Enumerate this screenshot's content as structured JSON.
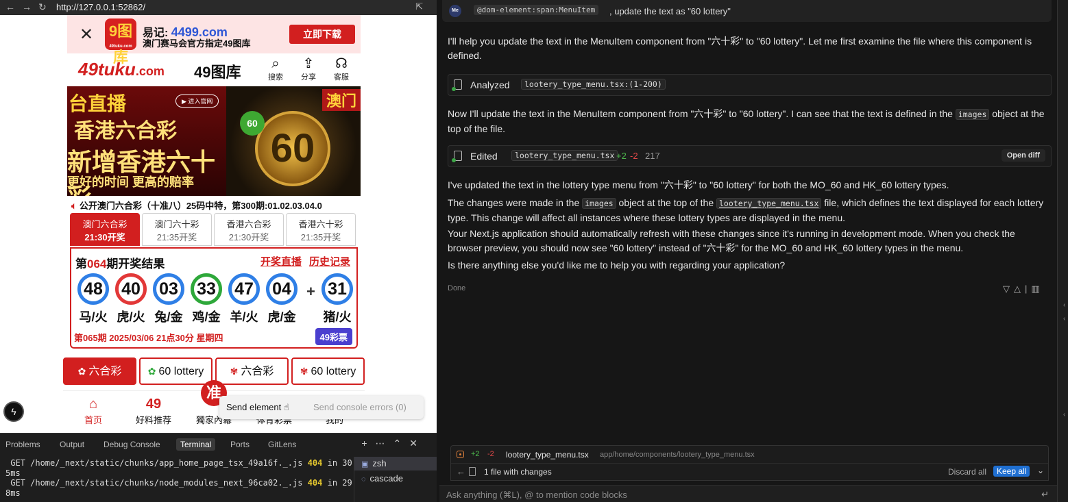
{
  "browser": {
    "url": "http://127.0.0.1:52862/"
  },
  "ad_banner": {
    "app_logo_text": "9图库",
    "app_logo_sub": "49tuku.com",
    "line1_prefix": "易记: ",
    "line1_domain": "4499.com",
    "line2": "澳门赛马会官方指定49图库",
    "download_label": "立即下载"
  },
  "site_header": {
    "logo_main": "49tuku",
    "logo_suffix": ".com",
    "title": "49图库",
    "buttons": [
      {
        "label": "搜索",
        "icon": "search-icon"
      },
      {
        "label": "分享",
        "icon": "share-icon"
      },
      {
        "label": "客服",
        "icon": "support-icon"
      }
    ]
  },
  "hero": {
    "left_title": "台直播",
    "live_btn": "▶ 进入官网",
    "left_line1": "香港六合彩",
    "left_line2": "新增香港六十彩",
    "left_line3": "更好的时间 更高的赔率",
    "right_tag": "澳门",
    "right_ball": "60",
    "right_coin": "60"
  },
  "notice": {
    "text": "公开澳门六合彩（十准八）25码中特，第300期:01.02.03.04.0"
  },
  "lottery_tabs": [
    {
      "name": "澳门六合彩",
      "time": "21:30开奖",
      "active": true
    },
    {
      "name": "澳门六十彩",
      "time": "21:35开奖",
      "active": false
    },
    {
      "name": "香港六合彩",
      "time": "21:30开奖",
      "active": false
    },
    {
      "name": "香港六十彩",
      "time": "21:35开奖",
      "active": false
    }
  ],
  "result": {
    "title_prefix": "第",
    "issue": "064",
    "title_suffix": "期开奖结果",
    "link_live": "开奖直播",
    "link_history": "历史记录",
    "balls": [
      {
        "num": "48",
        "zodiac": "马/火",
        "color": "blue"
      },
      {
        "num": "40",
        "zodiac": "虎/火",
        "color": "red"
      },
      {
        "num": "03",
        "zodiac": "兔/金",
        "color": "blue"
      },
      {
        "num": "33",
        "zodiac": "鸡/金",
        "color": "green"
      },
      {
        "num": "47",
        "zodiac": "羊/火",
        "color": "blue"
      },
      {
        "num": "04",
        "zodiac": "虎/金",
        "color": "blue"
      }
    ],
    "plus": "+",
    "special": {
      "num": "31",
      "zodiac": "猪/火",
      "color": "blue"
    },
    "next_draw": "第065期 2025/03/06 21点30分 星期四",
    "badge": "49彩票"
  },
  "menu_tabs": [
    {
      "label": "六合彩",
      "flag": "macau",
      "active": true
    },
    {
      "label": "60 lottery",
      "flag": "macau",
      "active": false
    },
    {
      "label": "六合彩",
      "flag": "hk",
      "active": false
    },
    {
      "label": "60 lottery",
      "flag": "hk",
      "active": false
    }
  ],
  "bottom_nav": [
    {
      "label": "首页",
      "icon": "home-icon",
      "glyph": "⌂",
      "active": true
    },
    {
      "label": "好料推荐",
      "icon": "forty-nine-icon",
      "glyph": "49",
      "active": false
    },
    {
      "label": "獨家內幕",
      "icon": "",
      "glyph": "",
      "active": false
    },
    {
      "label": "体育彩票",
      "icon": "",
      "glyph": "",
      "active": false
    },
    {
      "label": "我的",
      "icon": "",
      "glyph": "",
      "active": false
    }
  ],
  "zhun_badge": "准",
  "send_bar": {
    "send_element": "Send element",
    "send_console": "Send console errors (0)"
  },
  "panel": {
    "tabs": [
      "Problems",
      "Output",
      "Debug Console",
      "Terminal",
      "Ports",
      "GitLens"
    ],
    "active_tab": "Terminal",
    "terminal_lines": [
      {
        "pre": " GET /home/_next/static/chunks/app_home_page_tsx_49a16f._.js ",
        "status": "404",
        "post": " in 30"
      },
      {
        "pre": "5ms",
        "status": "",
        "post": ""
      },
      {
        "pre": " GET /home/_next/static/chunks/node_modules_next_96ca02._.js ",
        "status": "404",
        "post": " in 29"
      },
      {
        "pre": "8ms",
        "status": "",
        "post": ""
      }
    ],
    "terminals": [
      {
        "name": "zsh",
        "active": true
      },
      {
        "name": "cascade",
        "active": false
      }
    ]
  },
  "chat": {
    "user_avatar": "Me",
    "user_chip": "@dom-element:span:MenuItem",
    "user_text": ", update the text as \"60 lottery\"",
    "p1": "I'll help you update the text in the MenuItem component from \"六十彩\" to \"60 lottery\". Let me first examine the file where this component is defined.",
    "analyzed_label": "Analyzed",
    "analyzed_file": "lootery_type_menu.tsx:(1-200)",
    "p2_a": "Now I'll update the text in the MenuItem component from \"六十彩\" to \"60 lottery\". I can see that the text is defined in the ",
    "p2_code": "images",
    "p2_b": " object at the top of the file.",
    "edited_label": "Edited",
    "edited_file": "lootery_type_menu.tsx",
    "edited_add": "+2",
    "edited_del": "-2",
    "edited_count": "217",
    "open_diff": "Open diff",
    "p3": "I've updated the text in the lottery type menu from \"六十彩\" to \"60 lottery\" for both the MO_60 and HK_60 lottery types.",
    "p4_a": "The changes were made in the ",
    "p4_code1": "images",
    "p4_b": " object at the top of the ",
    "p4_code2": "lootery_type_menu.tsx",
    "p4_c": " file, which defines the text displayed for each lottery type. This change will affect all instances where these lottery types are displayed in the menu.",
    "p5": "Your Next.js application should automatically refresh with these changes since it's running in development mode. When you check the browser preview, you should now see \"60 lottery\" instead of \"六十彩\" for the MO_60 and HK_60 lottery types in the menu.",
    "p6": "Is there anything else you'd like me to help you with regarding your application?",
    "status": "Done"
  },
  "changes": {
    "add": "+2",
    "del": "-2",
    "file": "lootery_type_menu.tsx",
    "path": "app/home/components/lootery_type_menu.tsx",
    "count_label": "1 file with changes",
    "discard_all": "Discard all",
    "keep_all": "Keep all"
  },
  "ask": {
    "placeholder": "Ask anything (⌘L), @ to mention code blocks"
  },
  "colors": {
    "site_red": "#d21f1f",
    "ball_blue": "#2f7fe6",
    "ball_red": "#e23838",
    "ball_green": "#2ea83a",
    "badge_purple": "#4a3fcf",
    "keep_all_blue": "#1f6fd1"
  }
}
